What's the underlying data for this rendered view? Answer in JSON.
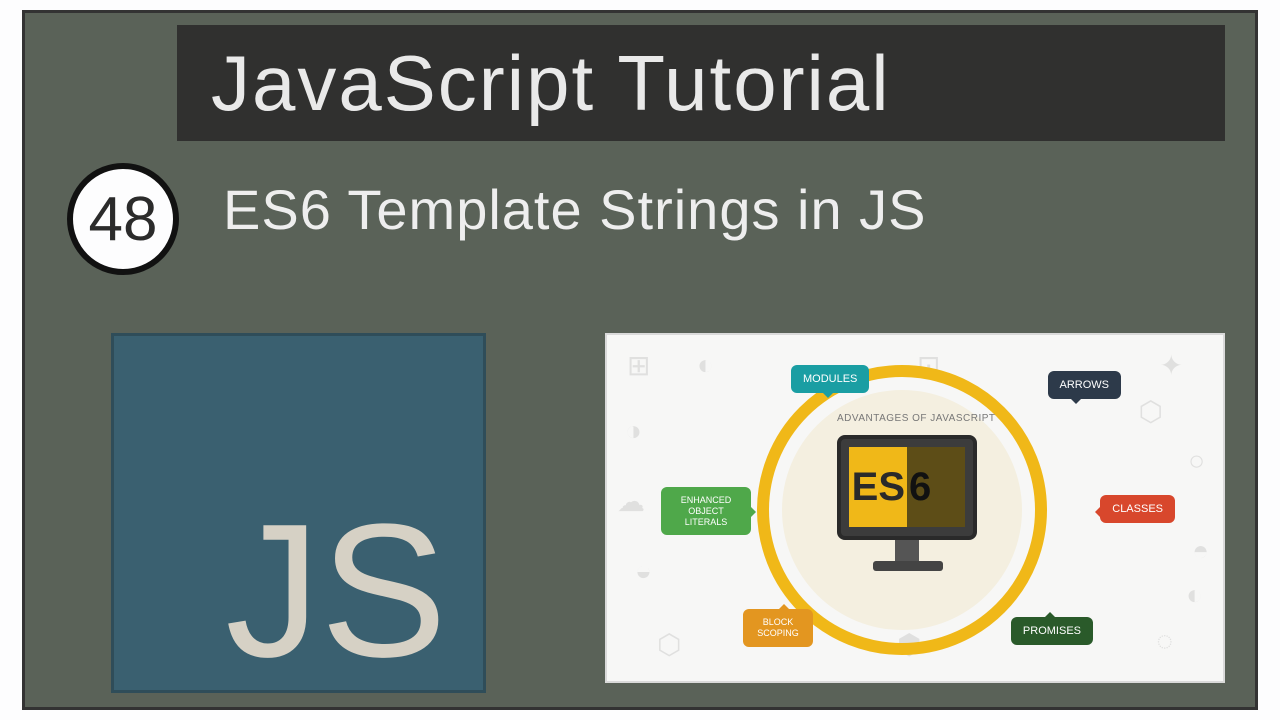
{
  "frame": {
    "title": "JavaScript Tutorial",
    "episode_number": "48",
    "subtitle": "ES6 Template Strings in JS"
  },
  "js_tile": {
    "logo_text": "JS"
  },
  "es6_card": {
    "heading": "ADVANTAGES OF JAVASCRIPT",
    "monitor_text_left": "ES",
    "monitor_text_right": "6",
    "bubbles": {
      "modules": "MODULES",
      "arrows": "ARROWS",
      "enhanced": "ENHANCED OBJECT LITERALS",
      "classes": "CLASSES",
      "block": "BLOCK SCOPING",
      "promises": "PROMISES"
    }
  },
  "colors": {
    "frame_bg": "#5a6258",
    "title_bar_bg": "#30302f",
    "js_tile_bg": "#3a6070",
    "ring_color": "#f0b818"
  }
}
